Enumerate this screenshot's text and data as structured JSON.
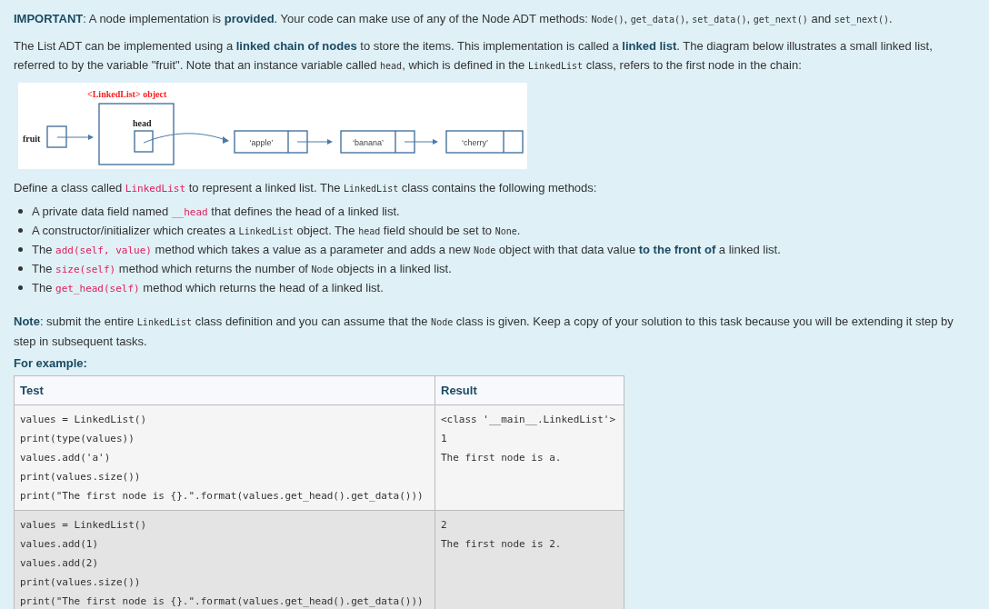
{
  "intro": [
    [
      {
        "kind": "bold",
        "text": "IMPORTANT"
      },
      {
        "kind": "text",
        "text": ": A node implementation is "
      },
      {
        "kind": "bold",
        "text": "provided"
      },
      {
        "kind": "text",
        "text": ". Your code can make use of any of the Node ADT methods: "
      },
      {
        "kind": "tt",
        "text": "Node()"
      },
      {
        "kind": "text",
        "text": ", "
      },
      {
        "kind": "tt",
        "text": "get_data()"
      },
      {
        "kind": "text",
        "text": ", "
      },
      {
        "kind": "tt",
        "text": "set_data()"
      },
      {
        "kind": "text",
        "text": ", "
      },
      {
        "kind": "tt",
        "text": "get_next()"
      },
      {
        "kind": "text",
        "text": " and "
      },
      {
        "kind": "tt",
        "text": "set_next()"
      },
      {
        "kind": "text",
        "text": "."
      }
    ],
    [
      {
        "kind": "text",
        "text": "The List ADT can be implemented using a "
      },
      {
        "kind": "bold",
        "text": "linked chain of nodes"
      },
      {
        "kind": "text",
        "text": " to store the items. This implementation is called a "
      },
      {
        "kind": "bold",
        "text": "linked list"
      },
      {
        "kind": "text",
        "text": ". The diagram below illustrates a small linked list, referred to by the variable \"fruit\". Note that an instance variable called "
      },
      {
        "kind": "tt",
        "text": "head"
      },
      {
        "kind": "text",
        "text": ", which is defined in the "
      },
      {
        "kind": "tt",
        "text": "LinkedList"
      },
      {
        "kind": "text",
        "text": " class, refers to the first node in the chain:"
      }
    ]
  ],
  "diagram": {
    "title": "<LinkedList> object",
    "variable": "fruit",
    "field": "head",
    "nodes": [
      "‘apple’",
      "‘banana’",
      "‘cherry’"
    ]
  },
  "define": [
    {
      "kind": "text",
      "text": "Define a class called "
    },
    {
      "kind": "code",
      "text": "LinkedList"
    },
    {
      "kind": "text",
      "text": " to represent a linked list. The "
    },
    {
      "kind": "tt",
      "text": "LinkedList"
    },
    {
      "kind": "text",
      "text": " class contains the following methods:"
    }
  ],
  "bullets": [
    [
      {
        "kind": "text",
        "text": "A private data field named "
      },
      {
        "kind": "code",
        "text": "__head"
      },
      {
        "kind": "text",
        "text": " that defines the head of a linked list."
      }
    ],
    [
      {
        "kind": "text",
        "text": "A constructor/initializer which creates a "
      },
      {
        "kind": "tt",
        "text": "LinkedList"
      },
      {
        "kind": "text",
        "text": " object. The "
      },
      {
        "kind": "tt",
        "text": "head"
      },
      {
        "kind": "text",
        "text": "  field should be set to "
      },
      {
        "kind": "tt",
        "text": "None"
      },
      {
        "kind": "text",
        "text": "."
      }
    ],
    [
      {
        "kind": "text",
        "text": "The "
      },
      {
        "kind": "code",
        "text": "add(self, value)"
      },
      {
        "kind": "text",
        "text": " method which takes a value as a parameter and adds a new "
      },
      {
        "kind": "tt",
        "text": "Node"
      },
      {
        "kind": "text",
        "text": " object with that data value "
      },
      {
        "kind": "bold",
        "text": "to the front of"
      },
      {
        "kind": "text",
        "text": " a linked list."
      }
    ],
    [
      {
        "kind": "text",
        "text": "The "
      },
      {
        "kind": "code",
        "text": "size(self)"
      },
      {
        "kind": "text",
        "text": " method which returns the number of "
      },
      {
        "kind": "tt",
        "text": "Node"
      },
      {
        "kind": "text",
        "text": " objects in a linked list."
      }
    ],
    [
      {
        "kind": "text",
        "text": "The "
      },
      {
        "kind": "code",
        "text": "get_head(self)"
      },
      {
        "kind": "text",
        "text": " method which returns the head of a linked list."
      }
    ]
  ],
  "note": [
    {
      "kind": "bold",
      "text": "Note"
    },
    {
      "kind": "text",
      "text": ": submit the entire "
    },
    {
      "kind": "tt",
      "text": "LinkedList"
    },
    {
      "kind": "text",
      "text": " class definition and you can assume that the "
    },
    {
      "kind": "tt",
      "text": "Node"
    },
    {
      "kind": "text",
      "text": " class is given. Keep a copy of your solution to this task because you will be extending it step by step in subsequent tasks."
    }
  ],
  "example_label": "For example:",
  "table": {
    "columns": [
      "Test",
      "Result"
    ],
    "rows": [
      {
        "test": "values = LinkedList()\nprint(type(values))\nvalues.add('a')\nprint(values.size())\nprint(\"The first node is {}.\".format(values.get_head().get_data()))",
        "result": "<class '__main__.LinkedList'>\n1\nThe first node is a."
      },
      {
        "test": "values = LinkedList()\nvalues.add(1)\nvalues.add(2)\nprint(values.size())\nprint(\"The first node is {}.\".format(values.get_head().get_data()))",
        "result": "2\nThe first node is 2."
      }
    ]
  }
}
